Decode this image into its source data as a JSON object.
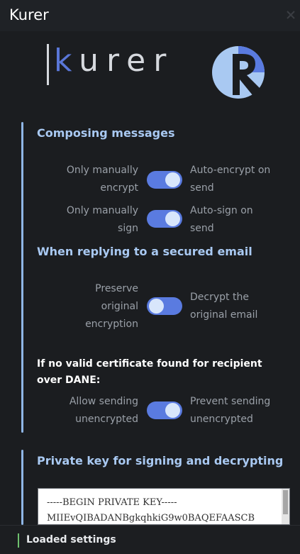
{
  "window": {
    "title": "Kurer"
  },
  "brand": {
    "wordmark_k": "k",
    "wordmark_rest": "urer"
  },
  "composing": {
    "title": "Composing messages",
    "encrypt": {
      "left": "Only manually encrypt",
      "right": "Auto-encrypt on send",
      "state": "on"
    },
    "sign": {
      "left": "Only manually sign",
      "right": "Auto-sign on send",
      "state": "on"
    }
  },
  "replying": {
    "title": "When replying to a secured email",
    "encryption": {
      "left": "Preserve original encryption",
      "right": "Decrypt the original email",
      "state": "off"
    }
  },
  "dane": {
    "note": "If no valid certificate found for recipient over DANE:",
    "sending": {
      "left": "Allow sending unencrypted",
      "right": "Prevent sending unencrypted",
      "state": "on"
    }
  },
  "private_key": {
    "title": "Private key for signing and decrypting",
    "lines": [
      "-----BEGIN PRIVATE KEY-----",
      "MIIEvQIBADANBgkqhkiG9w0BAQEFAASCB"
    ]
  },
  "status": {
    "text": "Loaded settings"
  },
  "colors": {
    "accent": "#5a7be0",
    "section_title": "#a9c9f2",
    "rule": "#8fb6e6",
    "status_ok": "#6ec16e"
  },
  "icons": {
    "close": "close-icon",
    "logo": "kurer-logo-icon"
  }
}
